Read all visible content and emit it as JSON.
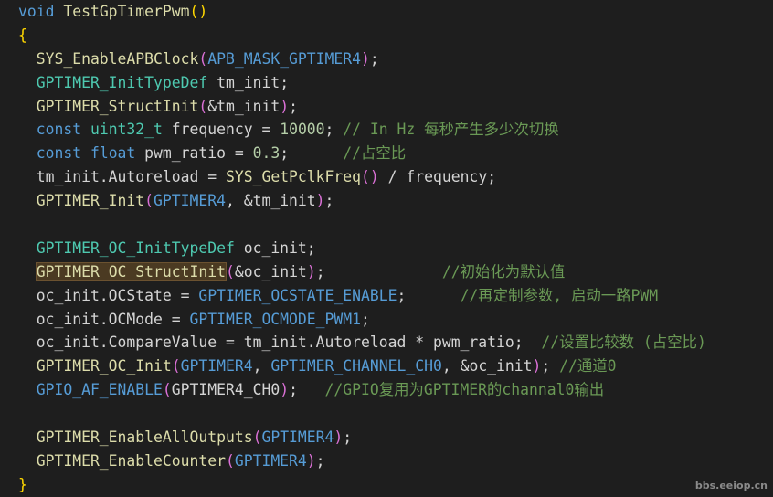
{
  "code": {
    "lines": [
      {
        "indent": false,
        "tokens": [
          {
            "t": "void ",
            "c": "kw"
          },
          {
            "t": "TestGpTimerPwm",
            "c": "fn"
          },
          {
            "t": "()",
            "c": "br1"
          }
        ]
      },
      {
        "indent": false,
        "tokens": [
          {
            "t": "{",
            "c": "br1"
          }
        ]
      },
      {
        "indent": true,
        "tokens": [
          {
            "t": "  SYS_EnableAPBClock",
            "c": "fn"
          },
          {
            "t": "(",
            "c": "br2"
          },
          {
            "t": "APB_MASK_GPTIMER4",
            "c": "mac"
          },
          {
            "t": ")",
            "c": "br2"
          },
          {
            "t": ";",
            "c": "op"
          }
        ]
      },
      {
        "indent": true,
        "tokens": [
          {
            "t": "  GPTIMER_InitTypeDef",
            "c": "ty"
          },
          {
            "t": " tm_init",
            "c": "id"
          },
          {
            "t": ";",
            "c": "op"
          }
        ]
      },
      {
        "indent": true,
        "tokens": [
          {
            "t": "  GPTIMER_StructInit",
            "c": "fn"
          },
          {
            "t": "(",
            "c": "br2"
          },
          {
            "t": "&tm_init",
            "c": "id"
          },
          {
            "t": ")",
            "c": "br2"
          },
          {
            "t": ";",
            "c": "op"
          }
        ]
      },
      {
        "indent": true,
        "tokens": [
          {
            "t": "  const ",
            "c": "kw"
          },
          {
            "t": "uint32_t",
            "c": "ty"
          },
          {
            "t": " frequency",
            "c": "id"
          },
          {
            "t": " = ",
            "c": "op"
          },
          {
            "t": "10000",
            "c": "num"
          },
          {
            "t": "; ",
            "c": "op"
          },
          {
            "t": "// In Hz 每秒产生多少次切换",
            "c": "cm"
          }
        ]
      },
      {
        "indent": true,
        "tokens": [
          {
            "t": "  const ",
            "c": "kw"
          },
          {
            "t": "float",
            "c": "kw"
          },
          {
            "t": " pwm_ratio",
            "c": "id"
          },
          {
            "t": " = ",
            "c": "op"
          },
          {
            "t": "0.3",
            "c": "num"
          },
          {
            "t": ";      ",
            "c": "op"
          },
          {
            "t": "//占空比",
            "c": "cm"
          }
        ]
      },
      {
        "indent": true,
        "tokens": [
          {
            "t": "  tm_init.Autoreload",
            "c": "id"
          },
          {
            "t": " = ",
            "c": "op"
          },
          {
            "t": "SYS_GetPclkFreq",
            "c": "fn"
          },
          {
            "t": "()",
            "c": "br2"
          },
          {
            "t": " / ",
            "c": "op"
          },
          {
            "t": "frequency",
            "c": "id"
          },
          {
            "t": ";",
            "c": "op"
          }
        ]
      },
      {
        "indent": true,
        "tokens": [
          {
            "t": "  GPTIMER_Init",
            "c": "fn"
          },
          {
            "t": "(",
            "c": "br2"
          },
          {
            "t": "GPTIMER4",
            "c": "mac"
          },
          {
            "t": ", &tm_init",
            "c": "id"
          },
          {
            "t": ")",
            "c": "br2"
          },
          {
            "t": ";",
            "c": "op"
          }
        ]
      },
      {
        "indent": true,
        "tokens": []
      },
      {
        "indent": true,
        "tokens": [
          {
            "t": "  GPTIMER_OC_InitTypeDef",
            "c": "ty"
          },
          {
            "t": " oc_init",
            "c": "id"
          },
          {
            "t": ";",
            "c": "op"
          }
        ]
      },
      {
        "indent": true,
        "tokens": [
          {
            "t": "  ",
            "c": "op"
          },
          {
            "t": "GPTIMER_OC_StructInit",
            "c": "fn",
            "hl": true
          },
          {
            "t": "(",
            "c": "br2"
          },
          {
            "t": "&oc_init",
            "c": "id"
          },
          {
            "t": ")",
            "c": "br2"
          },
          {
            "t": ";             ",
            "c": "op"
          },
          {
            "t": "//初始化为默认值",
            "c": "cm"
          }
        ]
      },
      {
        "indent": true,
        "tokens": [
          {
            "t": "  oc_init.OCState",
            "c": "id"
          },
          {
            "t": " = ",
            "c": "op"
          },
          {
            "t": "GPTIMER_OCSTATE_ENABLE",
            "c": "mac"
          },
          {
            "t": ";      ",
            "c": "op"
          },
          {
            "t": "//再定制参数, 启动一路PWM",
            "c": "cm"
          }
        ]
      },
      {
        "indent": true,
        "tokens": [
          {
            "t": "  oc_init.OCMode",
            "c": "id"
          },
          {
            "t": " = ",
            "c": "op"
          },
          {
            "t": "GPTIMER_OCMODE_PWM1",
            "c": "mac"
          },
          {
            "t": ";",
            "c": "op"
          }
        ]
      },
      {
        "indent": true,
        "tokens": [
          {
            "t": "  oc_init.CompareValue",
            "c": "id"
          },
          {
            "t": " = ",
            "c": "op"
          },
          {
            "t": "tm_init.Autoreload",
            "c": "id"
          },
          {
            "t": " * ",
            "c": "op"
          },
          {
            "t": "pwm_ratio",
            "c": "id"
          },
          {
            "t": ";  ",
            "c": "op"
          },
          {
            "t": "//设置比较数 (占空比)",
            "c": "cm"
          }
        ]
      },
      {
        "indent": true,
        "tokens": [
          {
            "t": "  GPTIMER_OC_Init",
            "c": "fn"
          },
          {
            "t": "(",
            "c": "br2"
          },
          {
            "t": "GPTIMER4",
            "c": "mac"
          },
          {
            "t": ", ",
            "c": "op"
          },
          {
            "t": "GPTIMER_CHANNEL_CH0",
            "c": "mac"
          },
          {
            "t": ", &oc_init",
            "c": "id"
          },
          {
            "t": ")",
            "c": "br2"
          },
          {
            "t": "; ",
            "c": "op"
          },
          {
            "t": "//通道0",
            "c": "cm"
          }
        ]
      },
      {
        "indent": true,
        "tokens": [
          {
            "t": "  GPIO_AF_ENABLE",
            "c": "mac"
          },
          {
            "t": "(",
            "c": "br2"
          },
          {
            "t": "GPTIMER4_CH0",
            "c": "id"
          },
          {
            "t": ")",
            "c": "br2"
          },
          {
            "t": ";   ",
            "c": "op"
          },
          {
            "t": "//GPIO复用为GPTIMER的channal0输出",
            "c": "cm"
          }
        ]
      },
      {
        "indent": true,
        "tokens": []
      },
      {
        "indent": true,
        "tokens": [
          {
            "t": "  GPTIMER_EnableAllOutputs",
            "c": "fn"
          },
          {
            "t": "(",
            "c": "br2"
          },
          {
            "t": "GPTIMER4",
            "c": "mac"
          },
          {
            "t": ")",
            "c": "br2"
          },
          {
            "t": ";",
            "c": "op"
          }
        ]
      },
      {
        "indent": true,
        "tokens": [
          {
            "t": "  GPTIMER_EnableCounter",
            "c": "fn"
          },
          {
            "t": "(",
            "c": "br2"
          },
          {
            "t": "GPTIMER4",
            "c": "mac"
          },
          {
            "t": ")",
            "c": "br2"
          },
          {
            "t": ";",
            "c": "op"
          }
        ]
      },
      {
        "indent": false,
        "tokens": [
          {
            "t": "}",
            "c": "br1"
          }
        ]
      }
    ]
  },
  "watermark": "bbs.eeiop.cn",
  "colors": {
    "background": "#1e1e1e",
    "keyword": "#569cd6",
    "function": "#dcdcaa",
    "type": "#4ec9b0",
    "number": "#b5cea8",
    "comment": "#6a9955",
    "bracket_outer": "#ffd700",
    "bracket_inner": "#da70d6"
  }
}
